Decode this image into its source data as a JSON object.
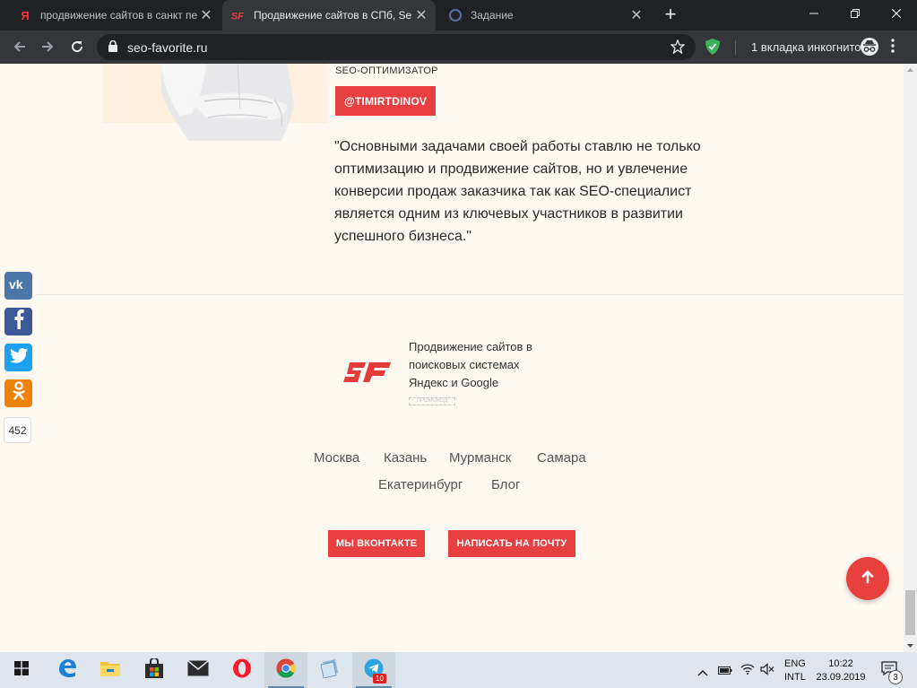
{
  "browser": {
    "tabs": [
      {
        "title": "продвижение сайтов в санкт пе",
        "favicon": "yandex-icon",
        "active": false
      },
      {
        "title": "Продвижение сайтов в СПб, Se",
        "favicon": "seo-favorite-icon",
        "active": true
      },
      {
        "title": "Задание",
        "favicon": "page-icon",
        "active": false
      }
    ],
    "url": "seo-favorite.ru",
    "incognito_label": "1 вкладка инкогнито"
  },
  "author": {
    "role": "SEO-ОПТИМИЗАТОР",
    "handle": "@TIMIRTDINOV",
    "quote": "\"Основными задачами своей работы ставлю не только оптимизацию и продвижение сайтов, но и увлечение конверсии продаж заказчика так как SEO-специалист является одним из ключевых участников в развитии успешного бизнеса.\""
  },
  "social": {
    "share_count": "452",
    "networks": [
      "vk-icon",
      "facebook-icon",
      "twitter-icon",
      "odnoklassniki-icon"
    ]
  },
  "footer": {
    "slogan_lines": [
      "Продвижение сайтов в",
      "поисковых системах",
      "Яндекс и Google"
    ],
    "promo": "ПРОМОКОД",
    "links": [
      "Москва",
      "Казань",
      "Мурманск",
      "Самара",
      "Екатеринбург",
      "Блог"
    ],
    "buttons": {
      "vk": "МЫ ВКОНТАКТЕ",
      "mail": "НАПИСАТЬ НА ПОЧТУ"
    }
  },
  "colors": {
    "accent": "#e84040",
    "page_bg": "#fff9f2"
  },
  "taskbar": {
    "lang_line1": "ENG",
    "lang_line2": "INTL",
    "time": "10:22",
    "date": "23.09.2019",
    "notifications": "3",
    "telegram_badge": "10"
  }
}
